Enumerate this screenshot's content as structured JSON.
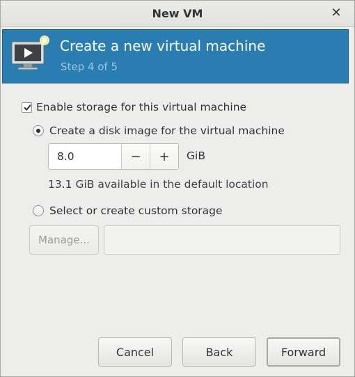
{
  "window": {
    "title": "New VM",
    "close_glyph": "✕"
  },
  "header": {
    "title": "Create a new virtual machine",
    "step": "Step 4 of 5",
    "icon": "vm-monitor-icon",
    "colors": {
      "background": "#2a7db0",
      "step_text": "#9cc6e6"
    }
  },
  "storage": {
    "enable_label": "Enable storage for this virtual machine",
    "enable_checked": true,
    "disk_option_label": "Create a disk image for the virtual machine",
    "disk_option_selected": true,
    "size_value": "8.0",
    "minus_glyph": "−",
    "plus_glyph": "+",
    "unit": "GiB",
    "available_text": "13.1 GiB available in the default location",
    "custom_option_label": "Select or create custom storage",
    "custom_option_selected": false,
    "manage_label": "Manage...",
    "custom_path_value": ""
  },
  "footer": {
    "cancel_label": "Cancel",
    "back_label": "Back",
    "forward_label": "Forward"
  }
}
